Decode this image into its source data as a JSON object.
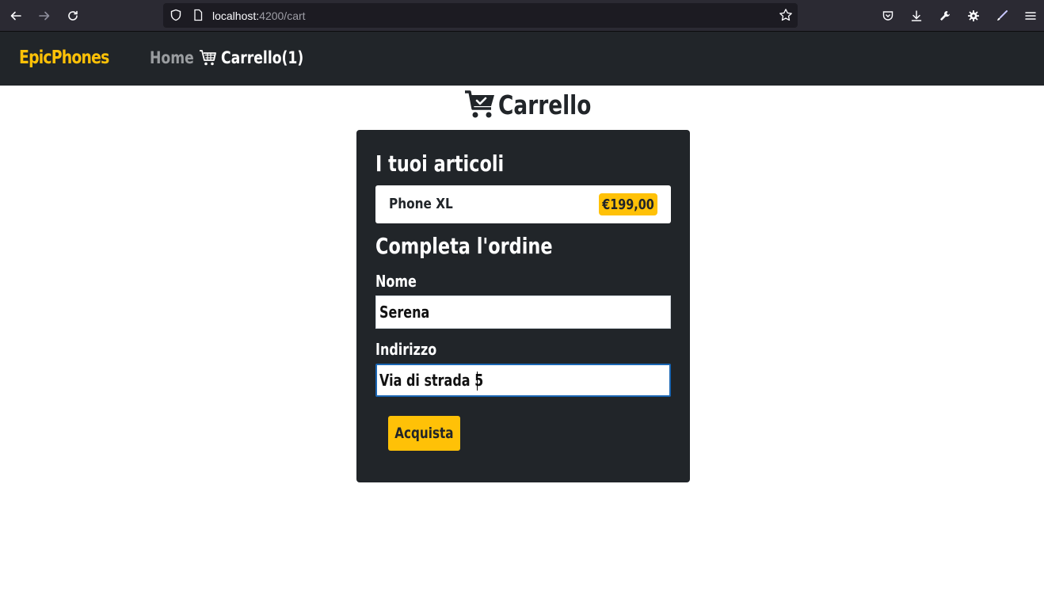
{
  "browser": {
    "url_host": "localhost:",
    "url_path": "4200/cart",
    "icons": [
      "back-icon",
      "forward-icon",
      "reload-icon",
      "shield-icon",
      "page-icon",
      "star-icon",
      "pocket-icon",
      "download-icon",
      "wrench-icon",
      "gear-icon",
      "brush-icon",
      "menu-icon"
    ]
  },
  "navbar": {
    "brand": "EpicPhones",
    "home": "Home",
    "cart": "Carrello(1)"
  },
  "page": {
    "title": "Carrello"
  },
  "cart": {
    "items_heading": "I tuoi articoli",
    "items": [
      {
        "name": "Phone XL",
        "price": "€199,00"
      }
    ]
  },
  "order": {
    "heading": "Completa l'ordine",
    "name_label": "Nome",
    "name_value": "Serena",
    "address_label": "Indirizzo",
    "address_value": "Via di strada 5",
    "submit_label": "Acquista"
  },
  "colors": {
    "accent": "#ffc107",
    "dark": "#212529",
    "focus": "#1a66b3"
  }
}
